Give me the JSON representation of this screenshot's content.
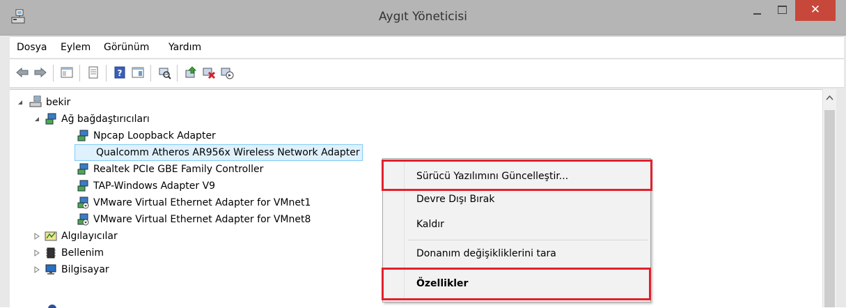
{
  "window": {
    "title": "Aygıt Yöneticisi",
    "close_symbol": "✕"
  },
  "menu": [
    "Dosya",
    "Eylem",
    "Görünüm",
    "Yardım"
  ],
  "tree": {
    "root": "bekir",
    "network_category": "Ağ bağdaştırıcıları",
    "adapters": [
      "Npcap Loopback Adapter",
      "Qualcomm Atheros AR956x Wireless Network Adapter",
      "Realtek PCIe GBE Family Controller",
      "TAP-Windows Adapter V9",
      "VMware Virtual Ethernet Adapter for VMnet1",
      "VMware Virtual Ethernet Adapter for VMnet8"
    ],
    "categories": [
      "Algılayıcılar",
      "Bellenim",
      "Bilgisayar"
    ]
  },
  "context_menu": {
    "update_driver": "Sürücü Yazılımını Güncelleştir...",
    "disable": "Devre Dışı Bırak",
    "uninstall": "Kaldır",
    "scan": "Donanım değişikliklerini tara",
    "properties": "Özellikler"
  },
  "colors": {
    "highlight_box": "#e3202d",
    "selection_bg": "#dff1fd",
    "close_button": "#c7483a"
  }
}
